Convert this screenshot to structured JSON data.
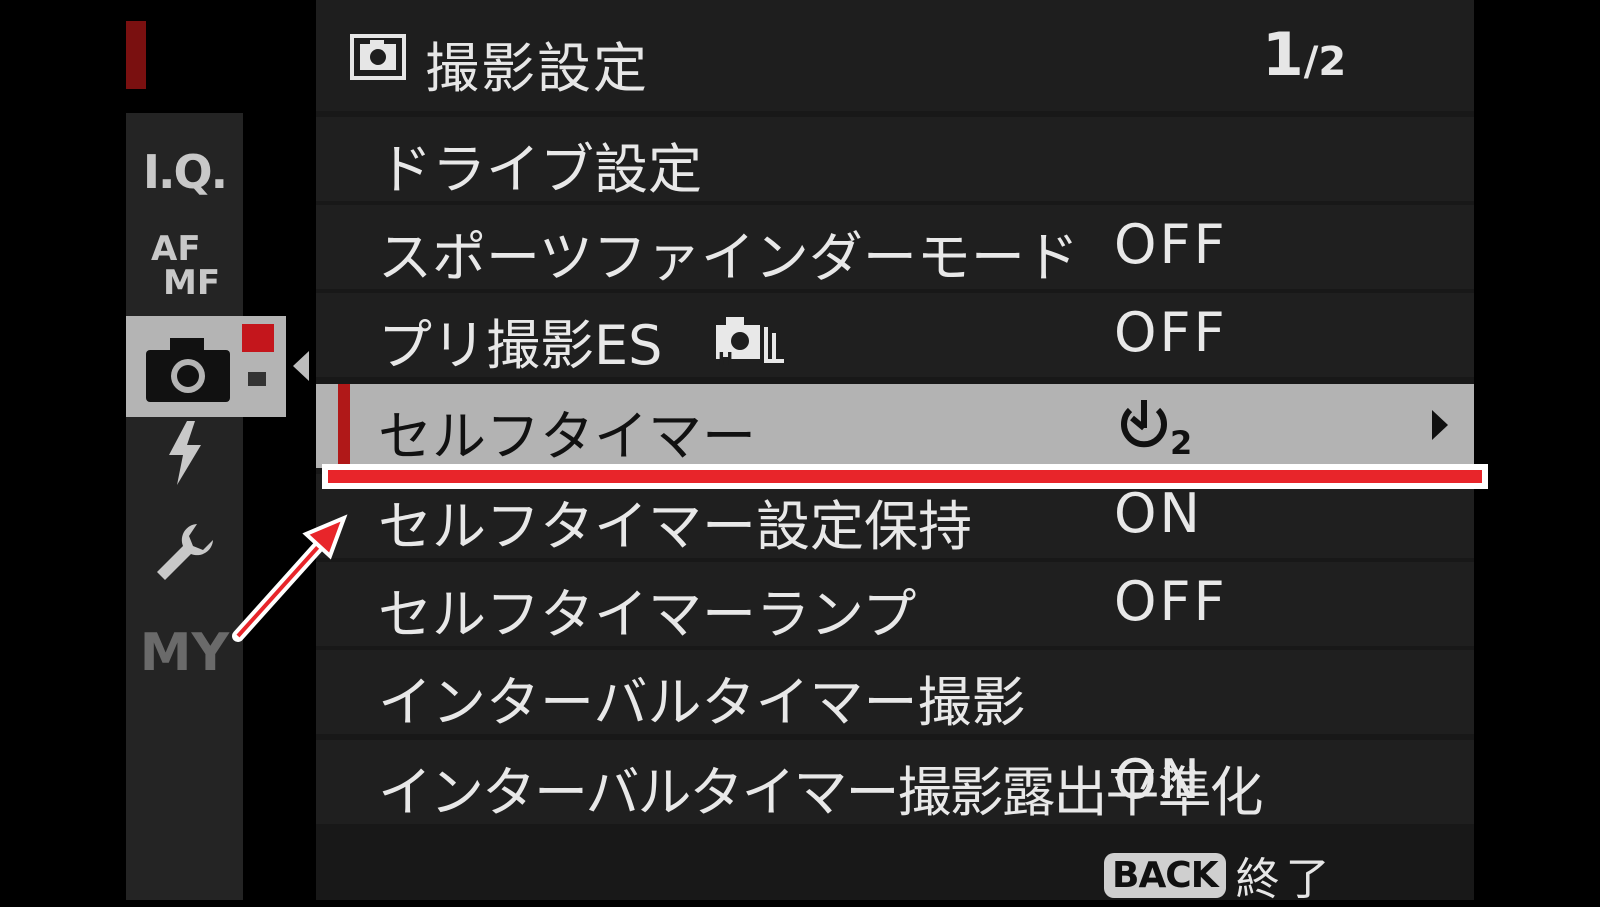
{
  "header": {
    "title": "撮影設定",
    "page_current": "1",
    "page_total": "/2"
  },
  "tabs": [
    {
      "label": "I.Q.",
      "icon": "iq-icon"
    },
    {
      "label": "AF\nMF",
      "icon": "af-mf-icon"
    },
    {
      "label": "",
      "icon": "camera-icon"
    },
    {
      "label": "",
      "icon": "flash-icon"
    },
    {
      "label": "",
      "icon": "wrench-icon"
    },
    {
      "label": "MY",
      "icon": "my-menu-icon"
    }
  ],
  "menu": {
    "items": [
      {
        "label": "ドライブ設定",
        "value": ""
      },
      {
        "label": "スポーツファインダーモード",
        "value": "OFF"
      },
      {
        "label": "プリ撮影ES",
        "value": "OFF"
      },
      {
        "label": "セルフタイマー",
        "value": "2"
      },
      {
        "label": "セルフタイマー設定保持",
        "value": "ON"
      },
      {
        "label": "セルフタイマーランプ",
        "value": "OFF"
      },
      {
        "label": "インターバルタイマー撮影",
        "value": ""
      },
      {
        "label": "インターバルタイマー撮影露出平準化",
        "value": "ON"
      }
    ]
  },
  "footer": {
    "back_key": "BACK",
    "back_label": "終了"
  },
  "colors": {
    "accent_red": "#e8252a",
    "selection_bg": "#b3b3b3",
    "selection_bar": "#b01818"
  }
}
